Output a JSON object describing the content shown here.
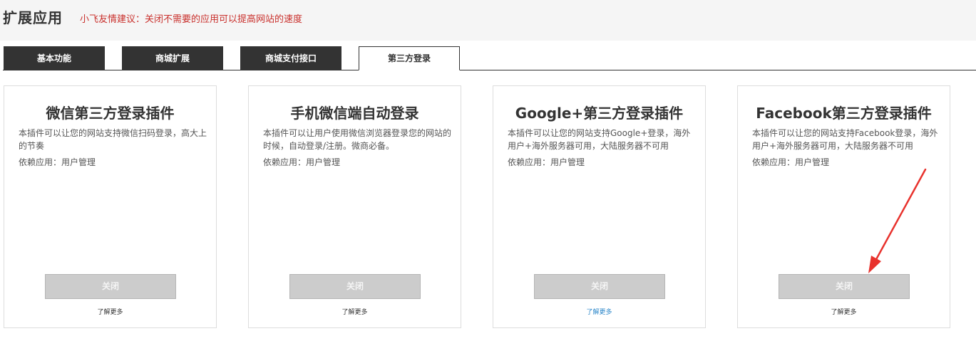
{
  "header": {
    "title": "扩展应用",
    "tip": "小飞友情建议：关闭不需要的应用可以提高网站的速度"
  },
  "tabs": [
    {
      "label": "基本功能",
      "active": false
    },
    {
      "label": "商城扩展",
      "active": false
    },
    {
      "label": "商城支付接口",
      "active": false
    },
    {
      "label": "第三方登录",
      "active": true
    }
  ],
  "plugins": [
    {
      "title": "微信第三方登录插件",
      "description": "本插件可以让您的网站支持微信扫码登录，高大上的节奏",
      "dependency": "依赖应用：用户管理",
      "button": "关闭",
      "more": "了解更多"
    },
    {
      "title": "手机微信端自动登录",
      "description": "本插件可以让用户使用微信浏览器登录您的网站的时候，自动登录/注册。微商必备。",
      "dependency": "依赖应用：用户管理",
      "button": "关闭",
      "more": "了解更多"
    },
    {
      "title": "Google+第三方登录插件",
      "description": "本插件可以让您的网站支持Google+登录，海外用户+海外服务器可用，大陆服务器不可用",
      "dependency": "依赖应用：用户管理",
      "button": "关闭",
      "more": "了解更多"
    },
    {
      "title": "Facebook第三方登录插件",
      "description": "本插件可以让您的网站支持Facebook登录，海外用户+海外服务器可用，大陆服务器不可用",
      "dependency": "依赖应用：用户管理",
      "button": "关闭",
      "more": "了解更多"
    }
  ],
  "colors": {
    "tip": "#c9302c",
    "tab_dark": "#333333",
    "button_gray": "#cccccc",
    "link_blue": "#2a86c9",
    "arrow_red": "#e8322d"
  }
}
